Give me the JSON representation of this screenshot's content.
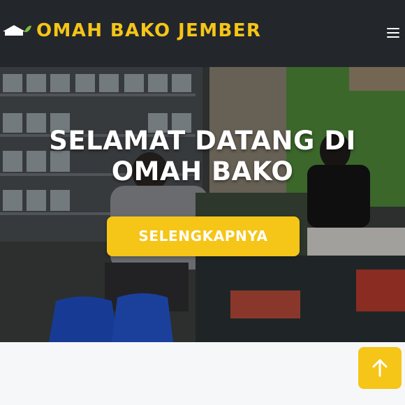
{
  "header": {
    "brand": "OMAH BAKO JEMBER",
    "logo_icon": "house-leaf-logo",
    "menu_icon": "hamburger-menu-icon",
    "accent_color": "#f5c518",
    "background_color": "#23272b"
  },
  "hero": {
    "title": "SELAMAT DATANG DI OMAH BAKO",
    "button_label": "SELENGKAPNYA",
    "button_color": "#f5c518"
  },
  "back_to_top": {
    "icon": "arrow-up-icon"
  }
}
